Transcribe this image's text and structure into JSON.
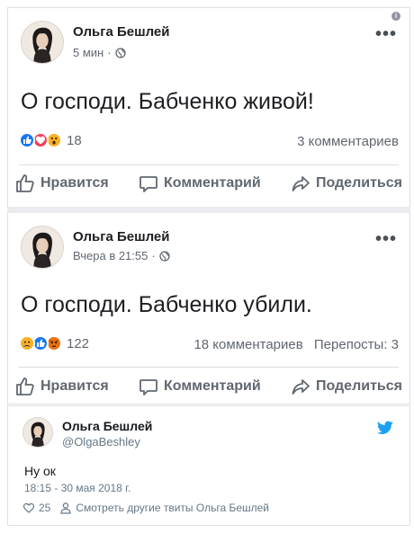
{
  "post1": {
    "author": "Ольга Бешлей",
    "time": "5 мин",
    "text": "О господи. Бабченко живой!",
    "reaction_count": "18",
    "comments": "3 комментариев",
    "reaction_icons": [
      "like-icon",
      "love-icon",
      "wow-icon"
    ]
  },
  "post2": {
    "author": "Ольга Бешлей",
    "time": "Вчера в 21:55",
    "text": "О господи. Бабченко убили.",
    "reaction_count": "122",
    "comments": "18 комментариев",
    "shares": "Перепосты: 3",
    "reaction_icons": [
      "sad-icon",
      "like-icon",
      "angry-icon"
    ]
  },
  "actions": {
    "like": "Нравится",
    "comment": "Комментарий",
    "share": "Поделиться"
  },
  "tweet": {
    "name": "Ольга Бешлей",
    "handle": "@OlgaBeshley",
    "text": "Ну ок",
    "date": "18:15 - 30 мая 2018 г.",
    "likes": "25",
    "more_link": "Смотреть другие твиты Ольга Бешлей"
  },
  "colors": {
    "like_blue": "#1877f2",
    "love_red": "#f33e58",
    "wow_yellow": "#f7b125",
    "angry_orange": "#e9710f",
    "twitter_blue": "#1da1f2",
    "gray_text": "#606770"
  }
}
